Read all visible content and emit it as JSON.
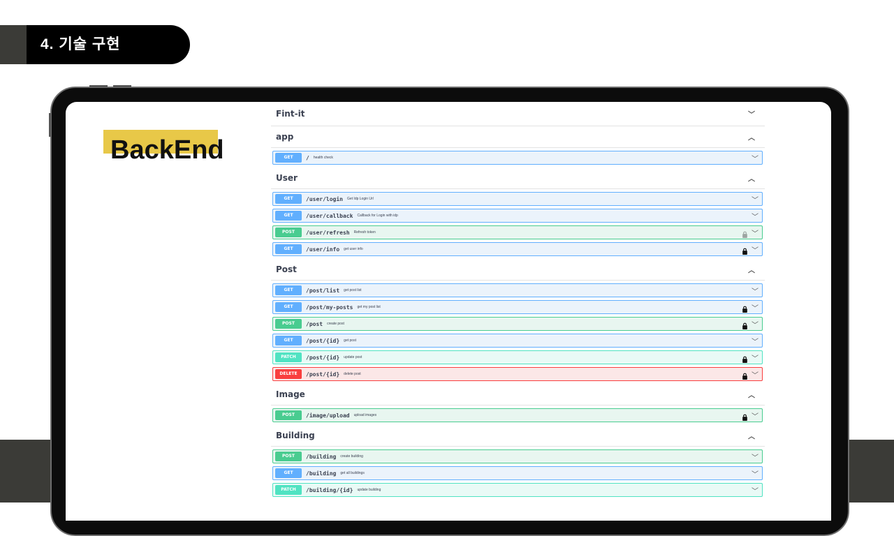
{
  "slide": {
    "heading": "4. 기술 구현"
  },
  "title": "BackEnd",
  "colors": {
    "get": "#61affe",
    "post": "#49cc90",
    "patch": "#50e3c2",
    "delete": "#f93e3e",
    "highlight": "#e8c848"
  },
  "icons": {
    "expand": "chevron-down-icon",
    "collapse": "chevron-up-icon",
    "auth": "lock-icon"
  },
  "swagger": {
    "sections": [
      {
        "name": "Fint-it",
        "expanded": false,
        "ops": []
      },
      {
        "name": "app",
        "expanded": true,
        "ops": [
          {
            "method": "GET",
            "path": "/",
            "desc": "health check",
            "lock": "none"
          }
        ]
      },
      {
        "name": "User",
        "expanded": true,
        "ops": [
          {
            "method": "GET",
            "path": "/user/login",
            "desc": "Get Idp Login Url",
            "lock": "none"
          },
          {
            "method": "GET",
            "path": "/user/callback",
            "desc": "Callback for Login with idp",
            "lock": "none"
          },
          {
            "method": "POST",
            "path": "/user/refresh",
            "desc": "Refresh token",
            "lock": "light"
          },
          {
            "method": "GET",
            "path": "/user/info",
            "desc": "get user info",
            "lock": "dark"
          }
        ]
      },
      {
        "name": "Post",
        "expanded": true,
        "ops": [
          {
            "method": "GET",
            "path": "/post/list",
            "desc": "get post list",
            "lock": "none"
          },
          {
            "method": "GET",
            "path": "/post/my-posts",
            "desc": "get my post list",
            "lock": "dark"
          },
          {
            "method": "POST",
            "path": "/post",
            "desc": "create post",
            "lock": "dark"
          },
          {
            "method": "GET",
            "path": "/post/{id}",
            "desc": "get post",
            "lock": "none"
          },
          {
            "method": "PATCH",
            "path": "/post/{id}",
            "desc": "update post",
            "lock": "dark"
          },
          {
            "method": "DELETE",
            "path": "/post/{id}",
            "desc": "delete post",
            "lock": "dark"
          }
        ]
      },
      {
        "name": "Image",
        "expanded": true,
        "ops": [
          {
            "method": "POST",
            "path": "/image/upload",
            "desc": "upload images",
            "lock": "dark"
          }
        ]
      },
      {
        "name": "Building",
        "expanded": true,
        "ops": [
          {
            "method": "POST",
            "path": "/building",
            "desc": "create building",
            "lock": "none"
          },
          {
            "method": "GET",
            "path": "/building",
            "desc": "get all buildings",
            "lock": "none"
          },
          {
            "method": "PATCH",
            "path": "/building/{id}",
            "desc": "update building",
            "lock": "none"
          }
        ]
      }
    ]
  }
}
